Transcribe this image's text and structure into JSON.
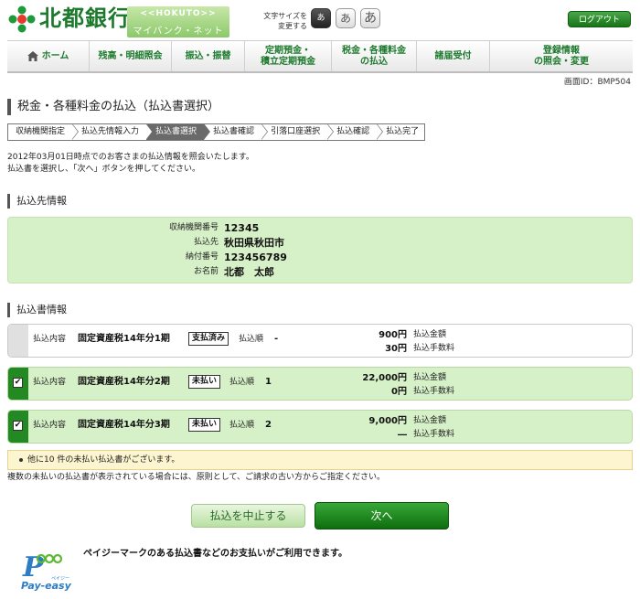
{
  "header": {
    "bank_name": "北都銀行",
    "sub_en": "<<HOKUTO>>",
    "sub_jp": "マイバンク・ネット",
    "font_size_label_1": "文字サイズを",
    "font_size_label_2": "変更する",
    "font_size_small": "あ",
    "font_size_mid": "あ",
    "font_size_large": "あ",
    "logout_label": "ログアウト"
  },
  "nav": {
    "home": "ホーム",
    "balance_1": "残高・明細照会",
    "transfer": "振込・振替",
    "deposit_1": "定期預金・",
    "deposit_2": "積立定期預金",
    "tax_1": "税金・各種料金",
    "tax_2": "の払込",
    "applications": "諸届受付",
    "registration_1": "登録情報",
    "registration_2": "の照会・変更"
  },
  "screen_id": "画面ID：BMP504",
  "page_title": "税金・各種料金の払込（払込書選択）",
  "steps": [
    "収納機関指定",
    "払込先情報入力",
    "払込書選択",
    "払込書確認",
    "引落口座選択",
    "払込確認",
    "払込完了"
  ],
  "intro": {
    "line1": "2012年03月01日時点でのお客さまの払込情報を照会いたします。",
    "line2": "払込書を選択し、「次へ」ボタンを押してください。"
  },
  "payee_section": {
    "title": "払込先情報",
    "rows": [
      {
        "label": "収納機関番号",
        "value": "12345"
      },
      {
        "label": "払込先",
        "value": "秋田県秋田市"
      },
      {
        "label": "納付番号",
        "value": "123456789"
      },
      {
        "label": "お名前",
        "value": "北都　太郎"
      }
    ]
  },
  "bill_section": {
    "title": "払込書情報",
    "content_label": "払込内容",
    "order_label": "払込順",
    "amount_label": "払込金額",
    "fee_label": "払込手数料",
    "bills": [
      {
        "content": "固定資産税14年分1期",
        "status": "支払済み",
        "order": "-",
        "amount": "900円",
        "fee": "30円",
        "checked": false
      },
      {
        "content": "固定資産税14年分2期",
        "status": "未払い",
        "order": "1",
        "amount": "22,000円",
        "fee": "0円",
        "checked": true
      },
      {
        "content": "固定資産税14年分3期",
        "status": "未払い",
        "order": "2",
        "amount": "9,000円",
        "fee": "―",
        "checked": true
      }
    ]
  },
  "notice": "他に10 件の未払い払込書がございます。",
  "note2": "複数の未払いの払込書が表示されている場合には、原則として、ご請求の古い方からご指定ください。",
  "buttons": {
    "cancel": "払込を中止する",
    "next": "次へ"
  },
  "payeasy": {
    "brand": "Pay-easy",
    "brand_kana": "ペイジー",
    "text": "ペイジーマークのある払込書などのお支払いがご利用できます。"
  },
  "colors": {
    "brand_green": "#1d7a2d",
    "light_green": "#d6f0c7",
    "button_green": "#238a23",
    "notice_yellow": "#fdf5cf"
  }
}
